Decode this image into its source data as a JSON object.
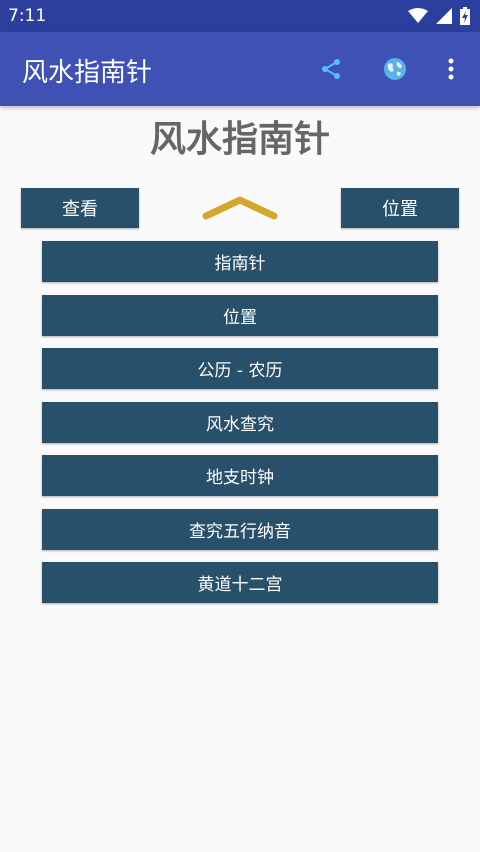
{
  "status_bar": {
    "time": "7:11",
    "icons": [
      "wifi-icon",
      "signal-icon",
      "battery-charging-icon"
    ]
  },
  "app_bar": {
    "title": "风水指南针",
    "actions": [
      "share-icon",
      "globe-icon",
      "more-vert-icon"
    ],
    "color": "#3f51b5"
  },
  "page_title": "风水指南针",
  "view_button": "查看",
  "position_button": "位置",
  "chevron_color": "#d4a72c",
  "button_color": "#28506b",
  "menu": [
    {
      "label": "指南针"
    },
    {
      "label": "位置"
    },
    {
      "label": "公历 - 农历"
    },
    {
      "label": "风水查究"
    },
    {
      "label": "地支时钟"
    },
    {
      "label": "查究五行纳音"
    },
    {
      "label": "黄道十二宫"
    }
  ]
}
